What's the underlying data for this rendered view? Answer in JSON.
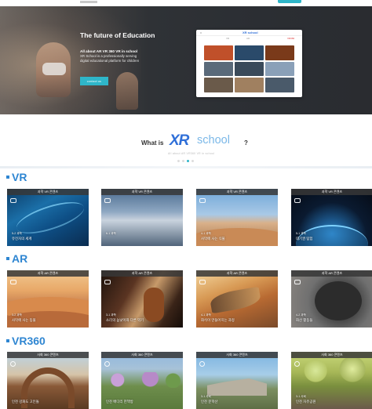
{
  "hero": {
    "title": "The future of Education",
    "subtitle": "All about AR VR 360 VR in school",
    "description_line1": "XR School is a professionally serving",
    "description_line2": "digital educational platform for children",
    "button_label": "contact us"
  },
  "mockup": {
    "logo": "XR school",
    "close": "x",
    "tabs": [
      "VR",
      "AR",
      "VR360"
    ],
    "thumb_colors": [
      "#c0502a",
      "#2a4a6a",
      "#7a3a1a",
      "#5a6a7a",
      "#3a4a5a",
      "#8aa0b8",
      "#6a5a4a",
      "#a08060",
      "#4a5a6a"
    ]
  },
  "intro": {
    "prefix": "What is",
    "logo_xr": "XR",
    "logo_school": "school",
    "suffix": "?",
    "tagline": "All about AR VR360 VR in school"
  },
  "sections": [
    {
      "title": "VR",
      "cards": [
        {
          "header": "과학 VR 콘텐츠",
          "grade": "5-2 과학",
          "name": "유전자의 세계",
          "bg": "bg-dna",
          "icon": "vr-headset-icon"
        },
        {
          "header": "과학 VR 콘텐츠",
          "grade": "6-1 과학",
          "name": "",
          "bg": "bg-bio",
          "icon": "vr-headset-icon"
        },
        {
          "header": "과학 VR 콘텐츠",
          "grade": "4-1 과학",
          "name": "사막에 사는 식물",
          "bg": "bg-desert1",
          "icon": "vr-headset-icon"
        },
        {
          "header": "과학 VR 콘텐츠",
          "grade": "5-1 과학",
          "name": "대기권 탐험",
          "bg": "bg-planet",
          "icon": "vr-headset-icon"
        }
      ]
    },
    {
      "title": "AR",
      "cards": [
        {
          "header": "과학 AR 콘텐츠",
          "grade": "3-2 과학",
          "name": "사막에 사는 동물",
          "bg": "bg-desert2",
          "icon": "camera-icon"
        },
        {
          "header": "과학 AR 콘텐츠",
          "grade": "3-1 과학",
          "name": "소리의 높낮이와 다른 악기",
          "bg": "bg-violin",
          "icon": "camera-icon"
        },
        {
          "header": "과학 AR 콘텐츠",
          "grade": "4-1 과학",
          "name": "화석이 만들어지는 과정",
          "bg": "bg-fossil",
          "icon": "camera-icon"
        },
        {
          "header": "과학 AR 콘텐츠",
          "grade": "4-2 과학",
          "name": "화산 활동들",
          "bg": "bg-volcano",
          "icon": "camera-icon"
        }
      ]
    },
    {
      "title": "VR360",
      "cards": [
        {
          "header": "사회 360 콘텐츠",
          "grade": "",
          "name": "인천 강화도 고인돌",
          "bg": "bg-gate",
          "icon": "360-icon"
        },
        {
          "header": "사회 360 콘텐츠",
          "grade": "",
          "name": "인천 배다리 헌책방",
          "bg": "bg-park",
          "icon": "360-icon"
        },
        {
          "header": "사회 360 콘텐츠",
          "grade": "3-1 사회",
          "name": "인천 문학산",
          "bg": "bg-fort",
          "icon": "360-icon"
        },
        {
          "header": "사회 360 콘텐츠",
          "grade": "3-1 사회",
          "name": "인천 자유공원",
          "bg": "bg-tree",
          "icon": "360-icon"
        }
      ]
    }
  ]
}
